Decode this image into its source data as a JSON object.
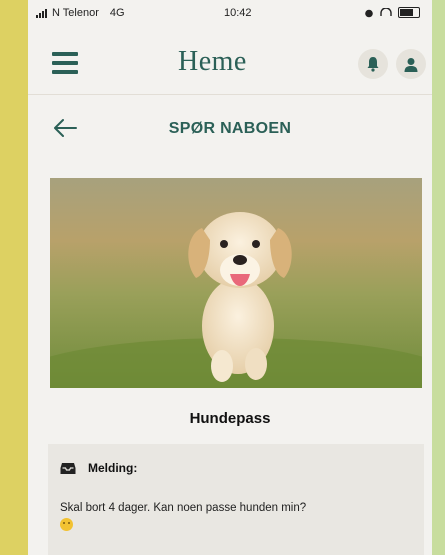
{
  "status_bar": {
    "carrier": "N Telenor",
    "network": "4G",
    "time": "10:42"
  },
  "app": {
    "logo": "Heme",
    "menu_icon": "hamburger-menu-icon",
    "bell_icon": "bell-icon",
    "user_icon": "user-icon",
    "accent_color": "#2b6057"
  },
  "page": {
    "title": "SPØR NABOEN",
    "back_icon": "arrow-left-icon"
  },
  "post": {
    "photo": "puppy-photo",
    "caption": "Hundepass",
    "message_label": "Melding:",
    "message_icon": "inbox-icon",
    "message_text": "Skal bort 4 dager. Kan noen passe hunden min?",
    "emoji": "smiling-face-emoji"
  }
}
